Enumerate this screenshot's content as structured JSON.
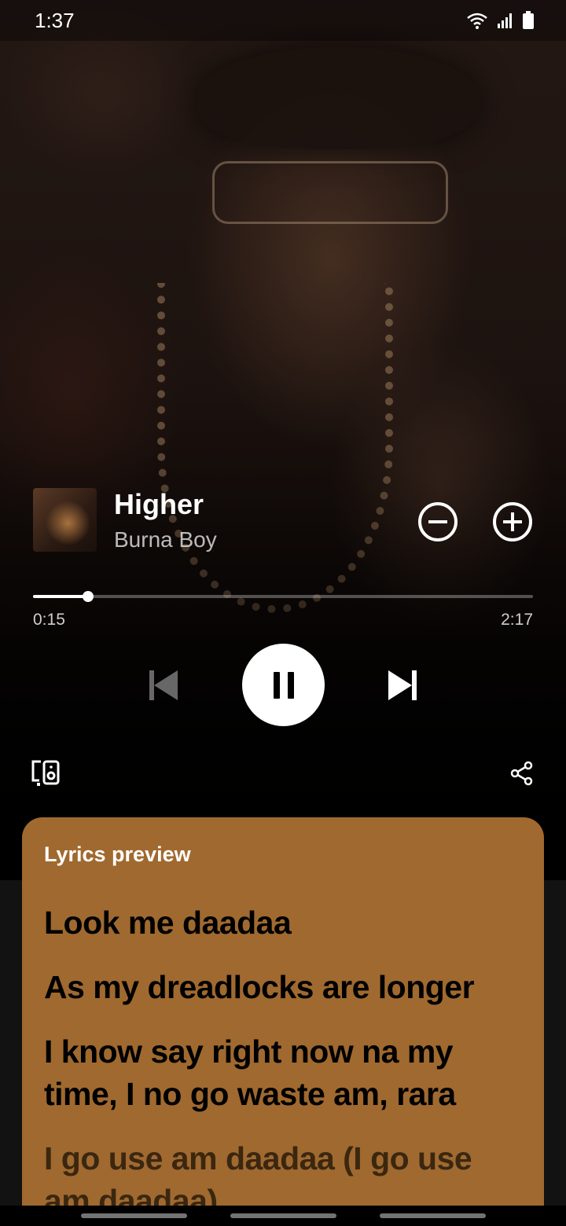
{
  "status_bar": {
    "time": "1:37",
    "icons": [
      "wifi-icon",
      "signal-icon",
      "battery-icon"
    ]
  },
  "track": {
    "title": "Higher",
    "artist": "Burna Boy",
    "cover_icon": "album-cover"
  },
  "actions": {
    "remove_icon": "minus-circle-icon",
    "add_icon": "plus-circle-icon"
  },
  "progress": {
    "elapsed": "0:15",
    "total": "2:17",
    "fraction": 0.11
  },
  "controls": {
    "previous_icon": "skip-previous-icon",
    "play_pause_icon": "pause-icon",
    "next_icon": "skip-next-icon",
    "devices_icon": "connect-devices-icon",
    "share_icon": "share-icon"
  },
  "lyrics": {
    "heading": "Lyrics preview",
    "lines": [
      "Look me daadaa",
      "As my dreadlocks are longer",
      "I know say right now na my time, I no go waste am, rara",
      "I go use am daadaa (I go use am daadaa)"
    ]
  },
  "colors": {
    "lyrics_card": "#a0692f",
    "accent": "#ffffff"
  }
}
